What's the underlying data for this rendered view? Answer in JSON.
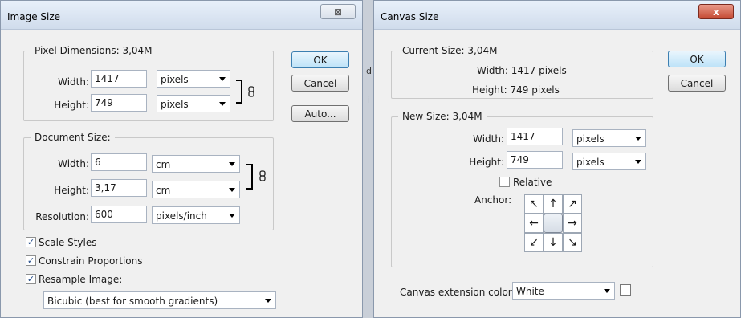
{
  "image_size": {
    "title": "Image Size",
    "pixel_dimensions": {
      "heading": "Pixel Dimensions:  3,04M",
      "width_label": "Width:",
      "width_value": "1417",
      "width_unit": "pixels",
      "height_label": "Height:",
      "height_value": "749",
      "height_unit": "pixels"
    },
    "document_size": {
      "heading": "Document Size:",
      "width_label": "Width:",
      "width_value": "6",
      "width_unit": "cm",
      "height_label": "Height:",
      "height_value": "3,17",
      "height_unit": "cm",
      "resolution_label": "Resolution:",
      "resolution_value": "600",
      "resolution_unit": "pixels/inch"
    },
    "buttons": {
      "ok": "OK",
      "cancel": "Cancel",
      "auto": "Auto..."
    },
    "options": {
      "scale_styles": "Scale Styles",
      "constrain": "Constrain Proportions",
      "resample": "Resample Image:",
      "method": "Bicubic (best for smooth gradients)",
      "check_mark": "✓"
    }
  },
  "canvas_size": {
    "title": "Canvas Size",
    "close_label": "x",
    "current": {
      "heading": "Current Size: 3,04M",
      "width": "Width:  1417 pixels",
      "height": "Height:  749 pixels"
    },
    "new_size": {
      "heading": "New Size: 3,04M",
      "width_label": "Width:",
      "width_value": "1417",
      "width_unit": "pixels",
      "height_label": "Height:",
      "height_value": "749",
      "height_unit": "pixels",
      "relative_label": "Relative",
      "anchor_label": "Anchor:",
      "arrows": [
        "↖",
        "↑",
        "↗",
        "←",
        "",
        "→",
        "↙",
        "↓",
        "↘"
      ]
    },
    "extension": {
      "label": "Canvas extension color:",
      "value": "White"
    },
    "buttons": {
      "ok": "OK",
      "cancel": "Cancel"
    }
  },
  "background_glyphs": {
    "a": "d",
    "b": "i"
  },
  "close_glyph": "⊠"
}
